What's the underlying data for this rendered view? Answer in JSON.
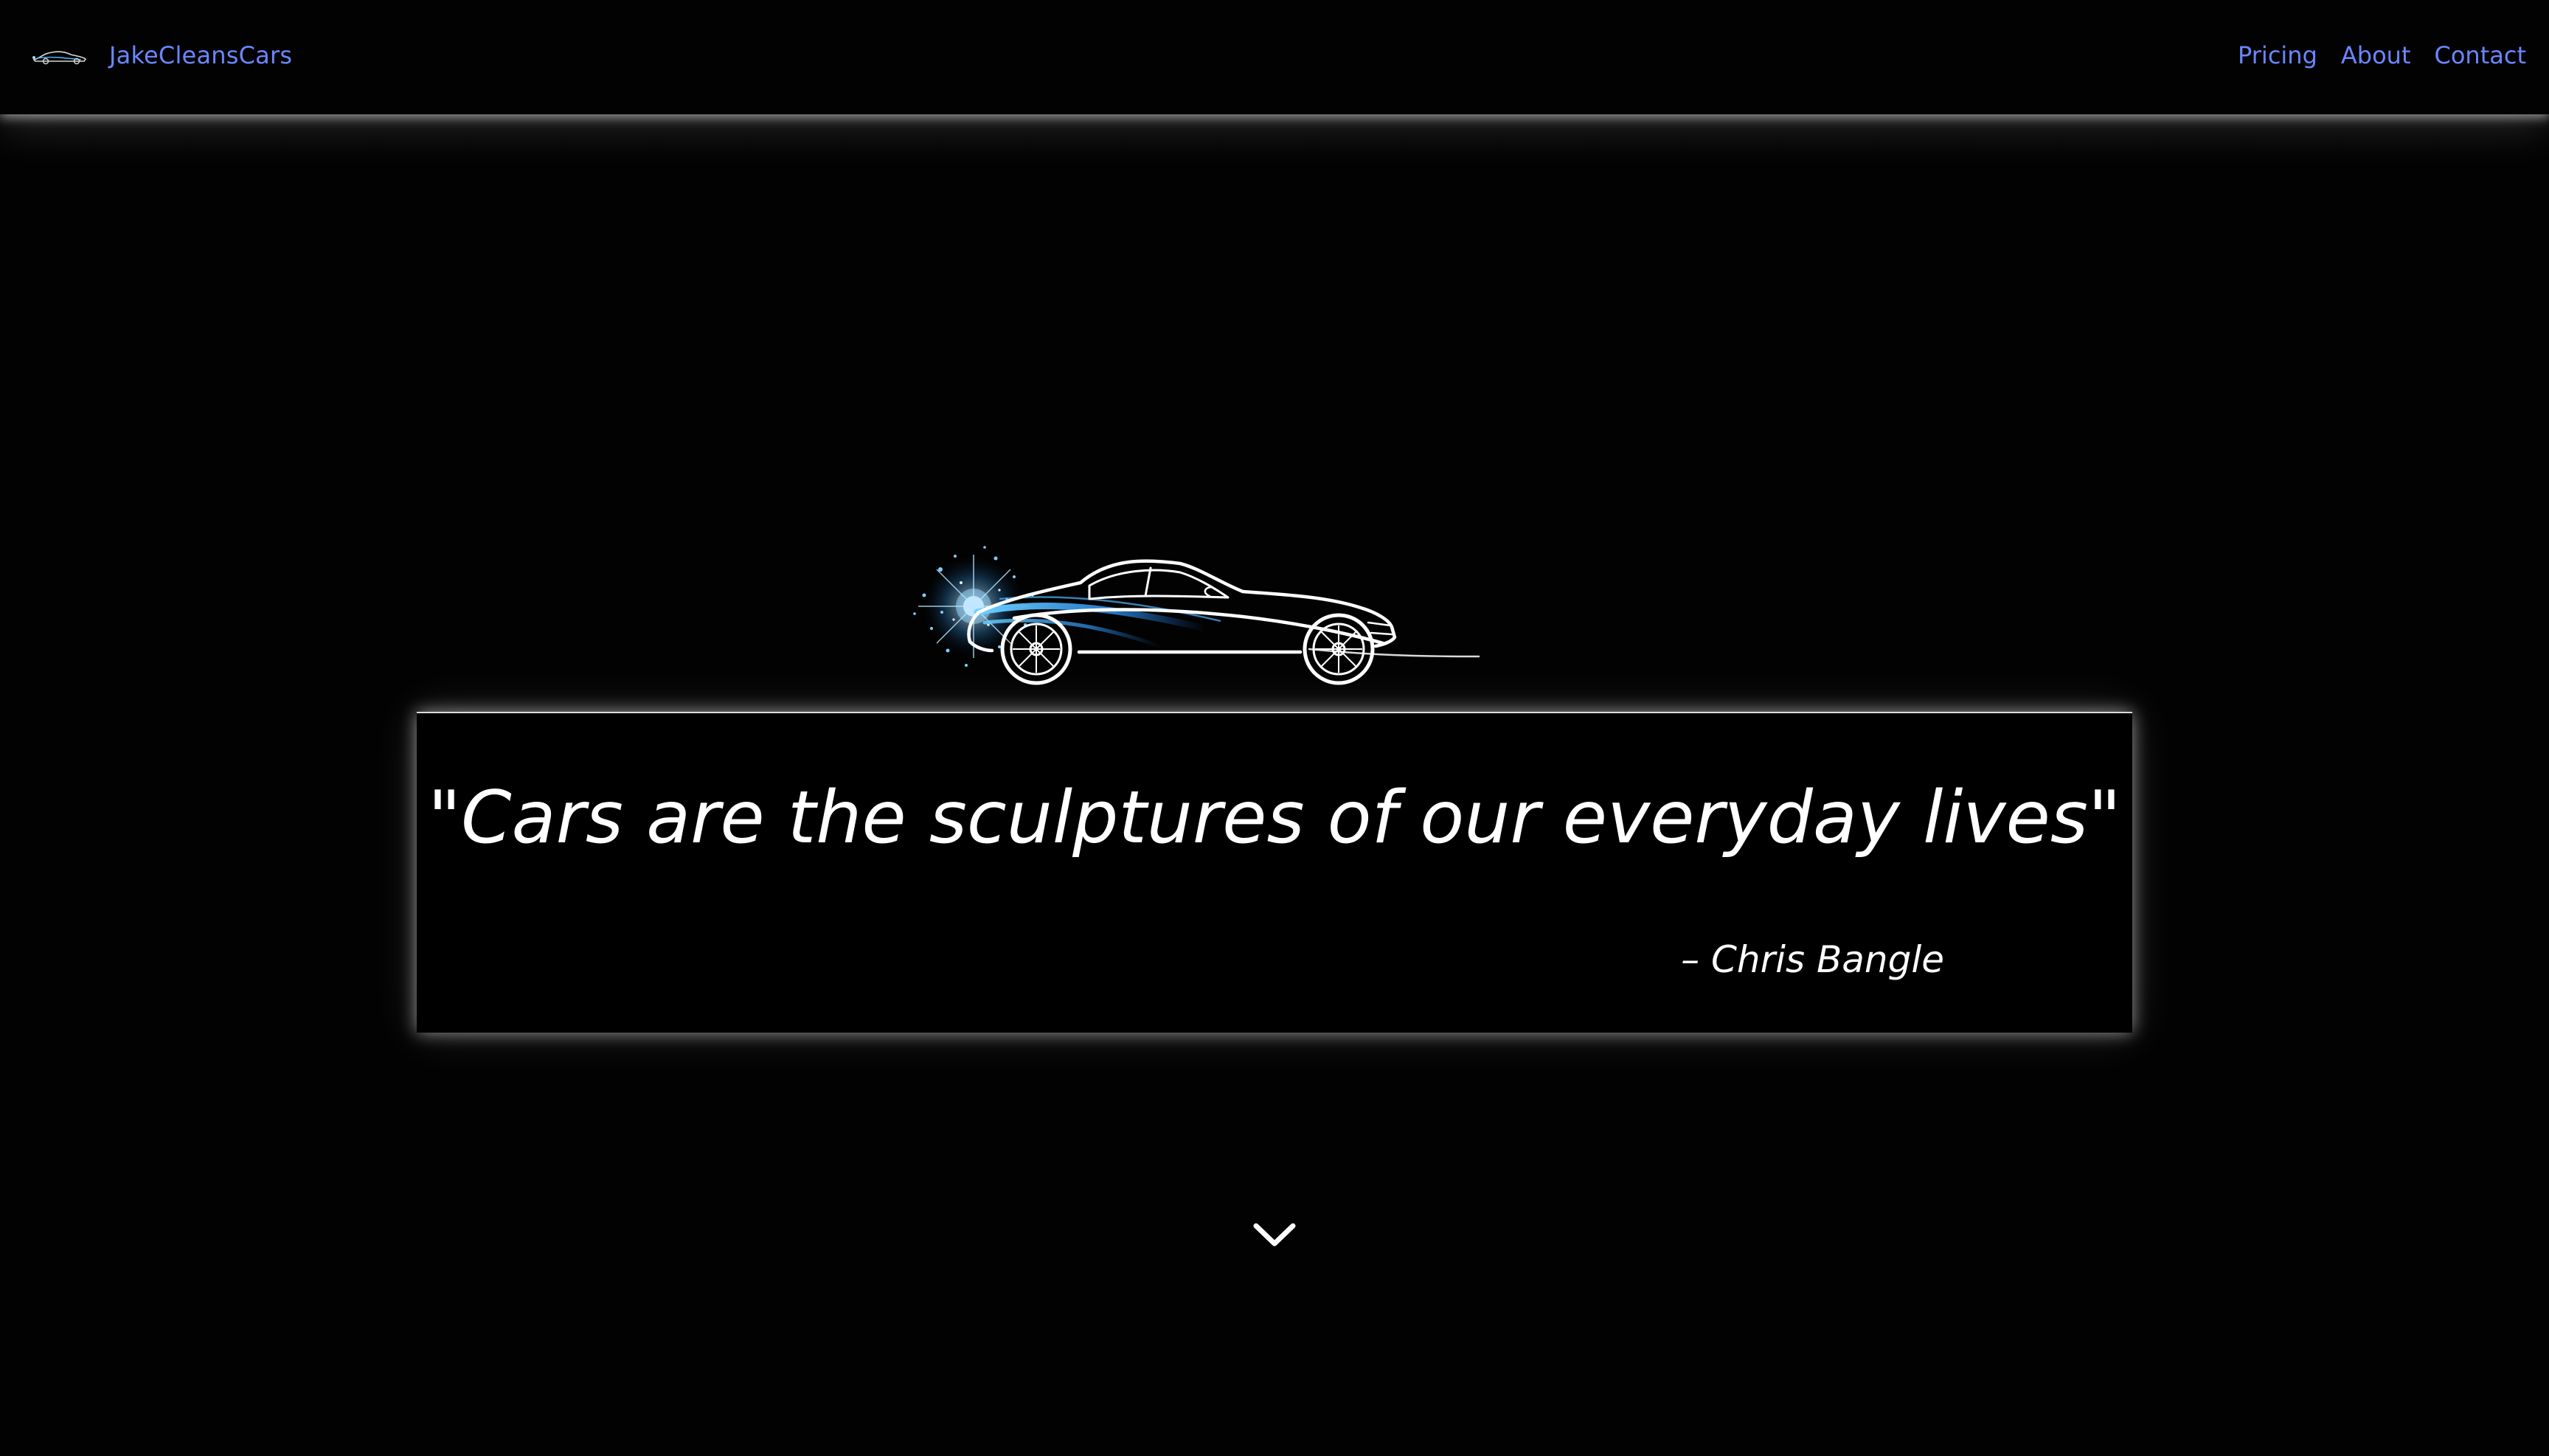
{
  "brand": {
    "name": "JakeCleansCars",
    "logo_icon": "car-silhouette-icon"
  },
  "nav": {
    "items": [
      {
        "label": "Pricing"
      },
      {
        "label": "About"
      },
      {
        "label": "Contact"
      }
    ]
  },
  "hero": {
    "image_icon": "sparkling-car-silhouette",
    "quote": "\"Cars are the sculptures of our everyday lives\"",
    "author": "– Chris Bangle",
    "scroll_icon": "chevron-down-icon"
  },
  "colors": {
    "background": "#020202",
    "link": "#6b86ff",
    "text": "#ffffff",
    "glow": "#ffffff",
    "accent_blue": "#4fb6ff"
  }
}
